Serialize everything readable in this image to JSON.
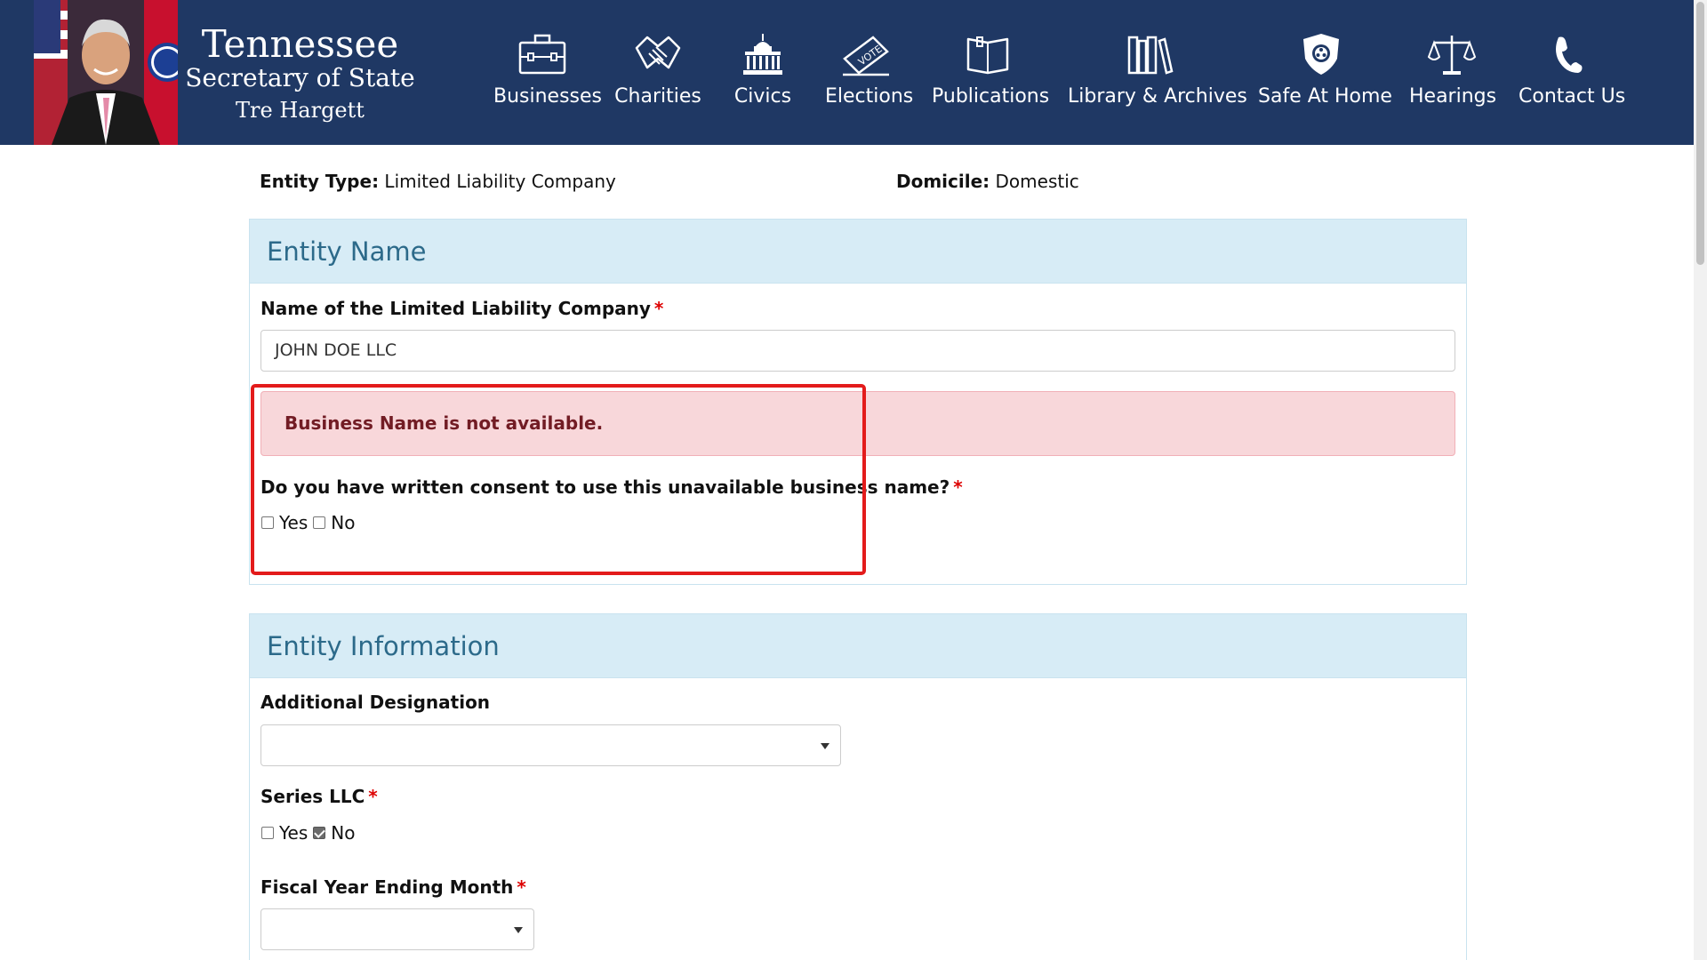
{
  "header": {
    "brand": {
      "line1": "Tennessee",
      "line2": "Secretary of State",
      "line3": "Tre Hargett"
    },
    "nav": [
      {
        "label": "Businesses",
        "icon": "briefcase-icon"
      },
      {
        "label": "Charities",
        "icon": "handshake-icon"
      },
      {
        "label": "Civics",
        "icon": "capitol-icon"
      },
      {
        "label": "Elections",
        "icon": "vote-icon"
      },
      {
        "label": "Publications",
        "icon": "book-icon"
      },
      {
        "label": "Library & Archives",
        "icon": "library-icon"
      },
      {
        "label": "Safe At Home",
        "icon": "shield-icon"
      },
      {
        "label": "Hearings",
        "icon": "scales-icon"
      },
      {
        "label": "Contact Us",
        "icon": "phone-icon"
      }
    ]
  },
  "meta": {
    "entity_type_label": "Entity Type:",
    "entity_type_value": "Limited Liability Company",
    "domicile_label": "Domicile:",
    "domicile_value": "Domestic"
  },
  "entity_name": {
    "title": "Entity Name",
    "name_label": "Name of the Limited Liability Company",
    "name_value": "JOHN DOE LLC",
    "required_mark": "*",
    "alert": "Business Name is not available.",
    "consent_question": "Do you have written consent to use this unavailable business name?",
    "consent_yes": "Yes",
    "consent_no": "No"
  },
  "entity_info": {
    "title": "Entity Information",
    "designation_label": "Additional Designation",
    "designation_value": "",
    "series_label": "Series LLC",
    "series_yes": "Yes",
    "series_no": "No",
    "series_checked": "No",
    "fiscal_label": "Fiscal Year Ending Month",
    "fiscal_value": ""
  },
  "colors": {
    "header_bg": "#1f3864",
    "panel_head_bg": "#d7ecf6",
    "panel_title": "#2c6a8a",
    "alert_bg": "#f8d7da",
    "alert_text": "#721c24",
    "highlight": "#e31b1b",
    "required": "#dd0000"
  }
}
